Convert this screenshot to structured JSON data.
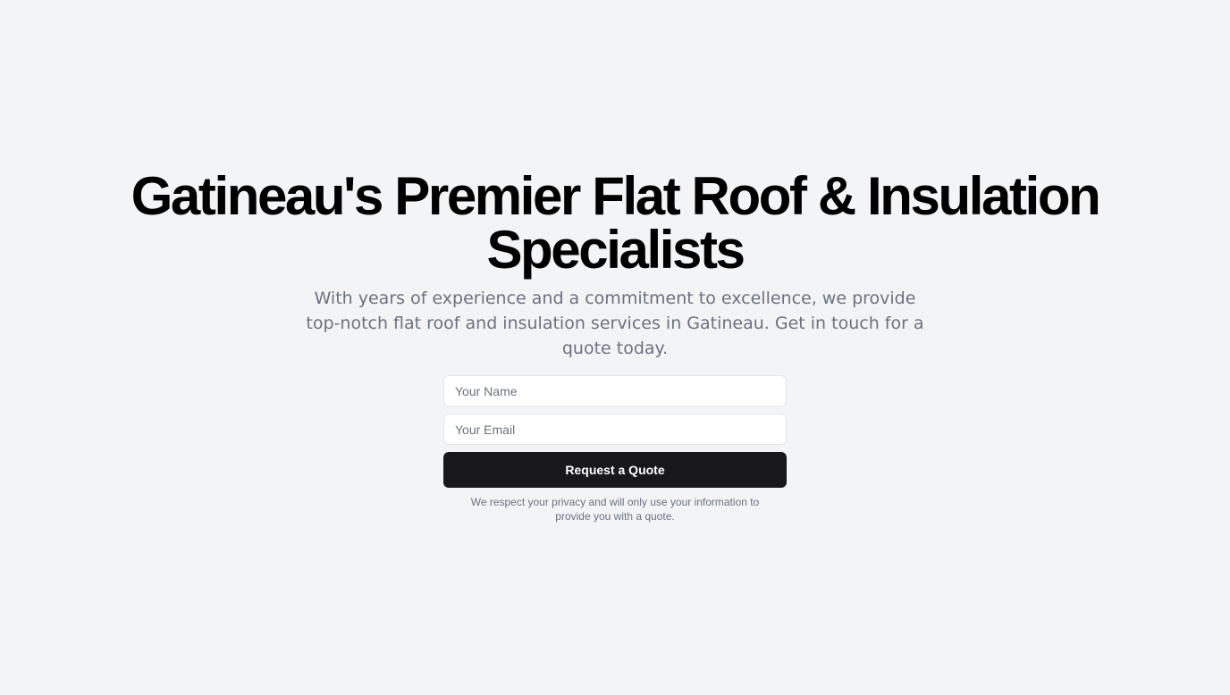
{
  "hero": {
    "headline": "Gatineau's Premier Flat Roof & Insulation Specialists",
    "subtext": "With years of experience and a commitment to excellence, we provide top-notch flat roof and insulation services in Gatineau. Get in touch for a quote today."
  },
  "form": {
    "name_placeholder": "Your Name",
    "name_value": "",
    "email_placeholder": "Your Email",
    "email_value": "",
    "submit_label": "Request a Quote",
    "privacy_note": "We respect your privacy and will only use your information to provide you with a quote."
  },
  "colors": {
    "background": "#f3f4f6",
    "headline": "#000000",
    "muted_text": "#6b7280",
    "button_bg": "#18181b",
    "button_text": "#ffffff",
    "input_border": "#e5e7eb"
  }
}
